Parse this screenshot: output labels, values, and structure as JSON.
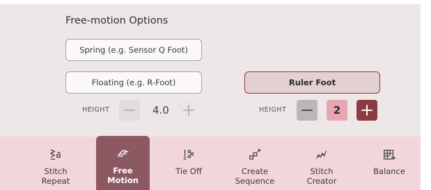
{
  "section": {
    "title": "Free-motion Options"
  },
  "options": {
    "spring_label": "Spring (e.g. Sensor Q Foot)",
    "floating_label": "Floating (e.g. R-Foot)",
    "ruler_label": "Ruler Foot"
  },
  "floating_height": {
    "label": "HEIGHT",
    "value": "4.0"
  },
  "ruler_height": {
    "label": "HEIGHT",
    "value": "2"
  },
  "toolbar": {
    "items": [
      {
        "line1": "Stitch",
        "line2": "Repeat",
        "icon": "stitch-repeat-icon"
      },
      {
        "line1": "Free",
        "line2": "Motion",
        "icon": "free-motion-icon",
        "active": true
      },
      {
        "line1": "Tie Off",
        "line2": "",
        "icon": "tie-off-icon"
      },
      {
        "line1": "Create",
        "line2": "Sequence",
        "icon": "create-sequence-icon"
      },
      {
        "line1": "Stitch",
        "line2": "Creator",
        "icon": "stitch-creator-icon"
      },
      {
        "line1": "Balance",
        "line2": "",
        "icon": "balance-icon"
      }
    ]
  },
  "colors": {
    "accent": "#8c3b45",
    "active_tab": "#8c5963",
    "toolbar_bg": "#f1d7db",
    "panel_bg": "#ede7e7",
    "value_highlight": "#e6a7b1"
  }
}
